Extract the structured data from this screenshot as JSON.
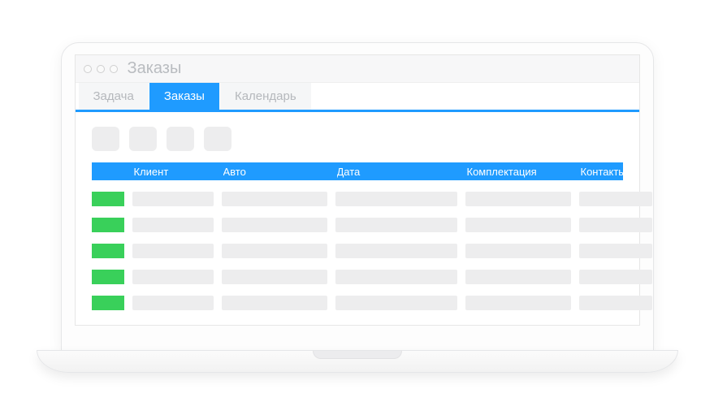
{
  "window": {
    "title": "Заказы"
  },
  "tabs": [
    {
      "label": "Задача",
      "active": false
    },
    {
      "label": "Заказы",
      "active": true
    },
    {
      "label": "Календарь",
      "active": false
    }
  ],
  "toolbar": {
    "buttons": [
      "btn1",
      "btn2",
      "btn3",
      "btn4"
    ]
  },
  "table": {
    "columns": [
      "",
      "Клиент",
      "Авто",
      "Дата",
      "Комплектация",
      "Контакты"
    ],
    "rows": [
      {
        "status": "green"
      },
      {
        "status": "green"
      },
      {
        "status": "green"
      },
      {
        "status": "green"
      },
      {
        "status": "green"
      }
    ]
  },
  "colors": {
    "accent": "#1f9bff",
    "status_green": "#39d05a",
    "placeholder": "#ededee"
  }
}
